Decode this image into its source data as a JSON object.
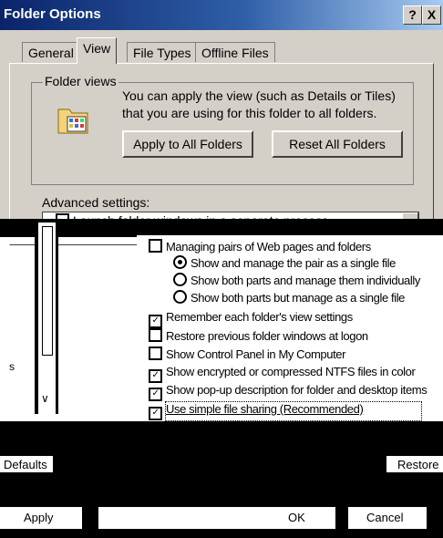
{
  "window": {
    "title": "Folder Options",
    "help_btn": "?",
    "close_btn": "X"
  },
  "tabs": [
    {
      "label": "General"
    },
    {
      "label": "View"
    },
    {
      "label": "File Types"
    },
    {
      "label": "Offline Files"
    }
  ],
  "folder_views": {
    "legend": "Folder views",
    "description": "You can apply the view (such as Details or Tiles) that you are using for this folder to all folders.",
    "apply_all_button": "Apply to All Folders",
    "reset_all_button": "Reset All Folders"
  },
  "advanced": {
    "label": "Advanced settings:",
    "items": [
      {
        "text": "Launch folder windows in a separate process",
        "kind": "checkbox",
        "checked": false
      },
      {
        "text": "Managing pairs of Web pages and folders",
        "kind": "group"
      },
      {
        "text": "Show and manage the pair as a single file",
        "kind": "radio",
        "checked": true
      },
      {
        "text": "Show both parts and manage them individually",
        "kind": "radio",
        "checked": false
      },
      {
        "text": "Show both parts but manage as a single file",
        "kind": "radio",
        "checked": false
      },
      {
        "text": "Remember each folder's view settings",
        "kind": "checkbox",
        "checked": true
      },
      {
        "text": "Restore previous folder windows at logon",
        "kind": "checkbox",
        "checked": false
      },
      {
        "text": "Show Control Panel in My Computer",
        "kind": "checkbox",
        "checked": false
      },
      {
        "text": "Show encrypted or compressed NTFS files in color",
        "kind": "checkbox",
        "checked": true
      },
      {
        "text": "Show pop-up description for folder and desktop items",
        "kind": "checkbox",
        "checked": true
      },
      {
        "text": "Use simple file sharing (Recommended)",
        "kind": "checkbox",
        "checked": true
      }
    ]
  },
  "fragments": {
    "left_s": "s",
    "defaults": "Defaults",
    "restore": "Restore",
    "apply": "Apply",
    "ok": "OK",
    "cancel": "Cancel"
  },
  "colors": {
    "titlebar_start": "#0a246a",
    "titlebar_end": "#a6caf0",
    "face": "#d4d0c8"
  }
}
